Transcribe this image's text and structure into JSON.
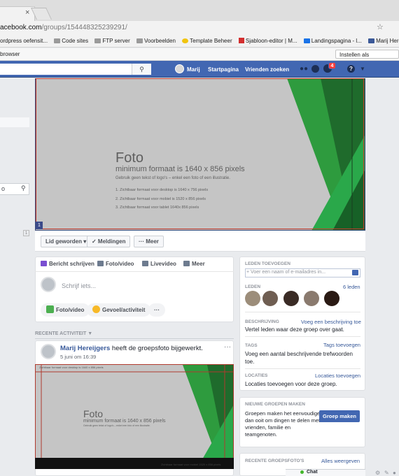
{
  "browser": {
    "tab_close": "×",
    "url_host": "acebook.com",
    "url_path": "/groups/154448325239291/",
    "star_icon": "☆",
    "bookmarks": [
      {
        "label": "ordpress oefensit...",
        "icon": "folder"
      },
      {
        "label": "Code sites",
        "icon": "folder"
      },
      {
        "label": "FTP server",
        "icon": "folder"
      },
      {
        "label": "Voorbeelden",
        "icon": "folder"
      },
      {
        "label": "Template Beheer",
        "icon": "yellow"
      },
      {
        "label": "Sjabloon-editor | M...",
        "icon": "red"
      },
      {
        "label": "Landingspagina - l...",
        "icon": "blue"
      },
      {
        "label": "Marij Hereijge",
        "icon": "facebook"
      }
    ],
    "infobar_text": "browser",
    "default_button": "Instellen als standaard"
  },
  "header": {
    "search_icon": "search-icon",
    "user_name": "Marij",
    "home": "Startpagina",
    "find_friends": "Vrienden zoeken",
    "notifications_count": "4",
    "help_glyph": "?",
    "caret": "▼"
  },
  "left": {
    "search_text": "o",
    "collapse": "1"
  },
  "cover": {
    "title": "Foto",
    "subtitle": "minimum formaat is 1640 x 856 pixels",
    "note": "Gebruik geen tekst of logo's – enkel een foto of een illustratie.",
    "lines": [
      "1. Zichtbaar formaat voor desktop is 1640 x 756 pixels",
      "2. Zichtbaar formaat voor mobiel is 1520 x 856 pixels",
      "3. Zichtbaar formaat voor tablet 1640x 856 pixels"
    ],
    "number_badge": "1",
    "buttons": {
      "joined": "Lid geworden ▾",
      "notifications": "✓ Meldingen",
      "more": "··· Meer"
    }
  },
  "composer": {
    "tabs": [
      "Bericht schrijven",
      "Foto/video",
      "Livevideo",
      "Meer"
    ],
    "placeholder": "Schrijf iets...",
    "actions": [
      "Foto/video",
      "Gevoel/activiteit",
      "···"
    ]
  },
  "recent": {
    "header": "RECENTE ACTIVITEIT ▼",
    "author": "Marij Hereijgers",
    "action": " heeft de groepsfoto bijgewerkt.",
    "time": "5 juni om 16:39",
    "more": "···",
    "image": {
      "label": "Zichtbaar formaat voor desktop is 1640 x 856 pixels",
      "title": "Foto",
      "subtitle": "minimum formaat is 1640 x 856 pixels",
      "note": "Gebruik geen tekst of logo's – enkel een foto of een illustratie.",
      "footer": "Zichtbaar formaat voor mobiel 1520 x 856 pixels"
    }
  },
  "right": {
    "add_members_header": "LEDEN TOEVOEGEN",
    "add_members_placeholder": "+ Voer een naam of e-mailadres in...",
    "members_header": "LEDEN",
    "members_count": "6 leden",
    "description_header": "BESCHRIJVING",
    "description_link": "Voeg een beschrijving toe",
    "description_text": "Vertel leden waar deze groep over gaat.",
    "tags_header": "TAGS",
    "tags_link": "Tags toevoegen",
    "tags_text": "Voeg een aantal beschrijvende trefwoorden toe.",
    "locations_header": "LOCATIES",
    "locations_link": "Locaties toevoegen",
    "locations_text": "Locaties toevoegen voor deze groep.",
    "new_groups_header": "NIEUWE GROEPEN MAKEN",
    "new_groups_text": "Groepen maken het eenvoudiger dan ooit om dingen te delen met vrienden, familie en teamgenoten.",
    "new_group_button": "Groep maken",
    "photos_header": "RECENTE GROEPSFOTO'S",
    "photos_link": "Alles weergeven",
    "chat": "Chat"
  },
  "colors": {
    "fb_blue": "#4267b2",
    "green": "#2e9b3e",
    "dark_green": "#1f6b2c",
    "notification_red": "#fa3e3e"
  }
}
